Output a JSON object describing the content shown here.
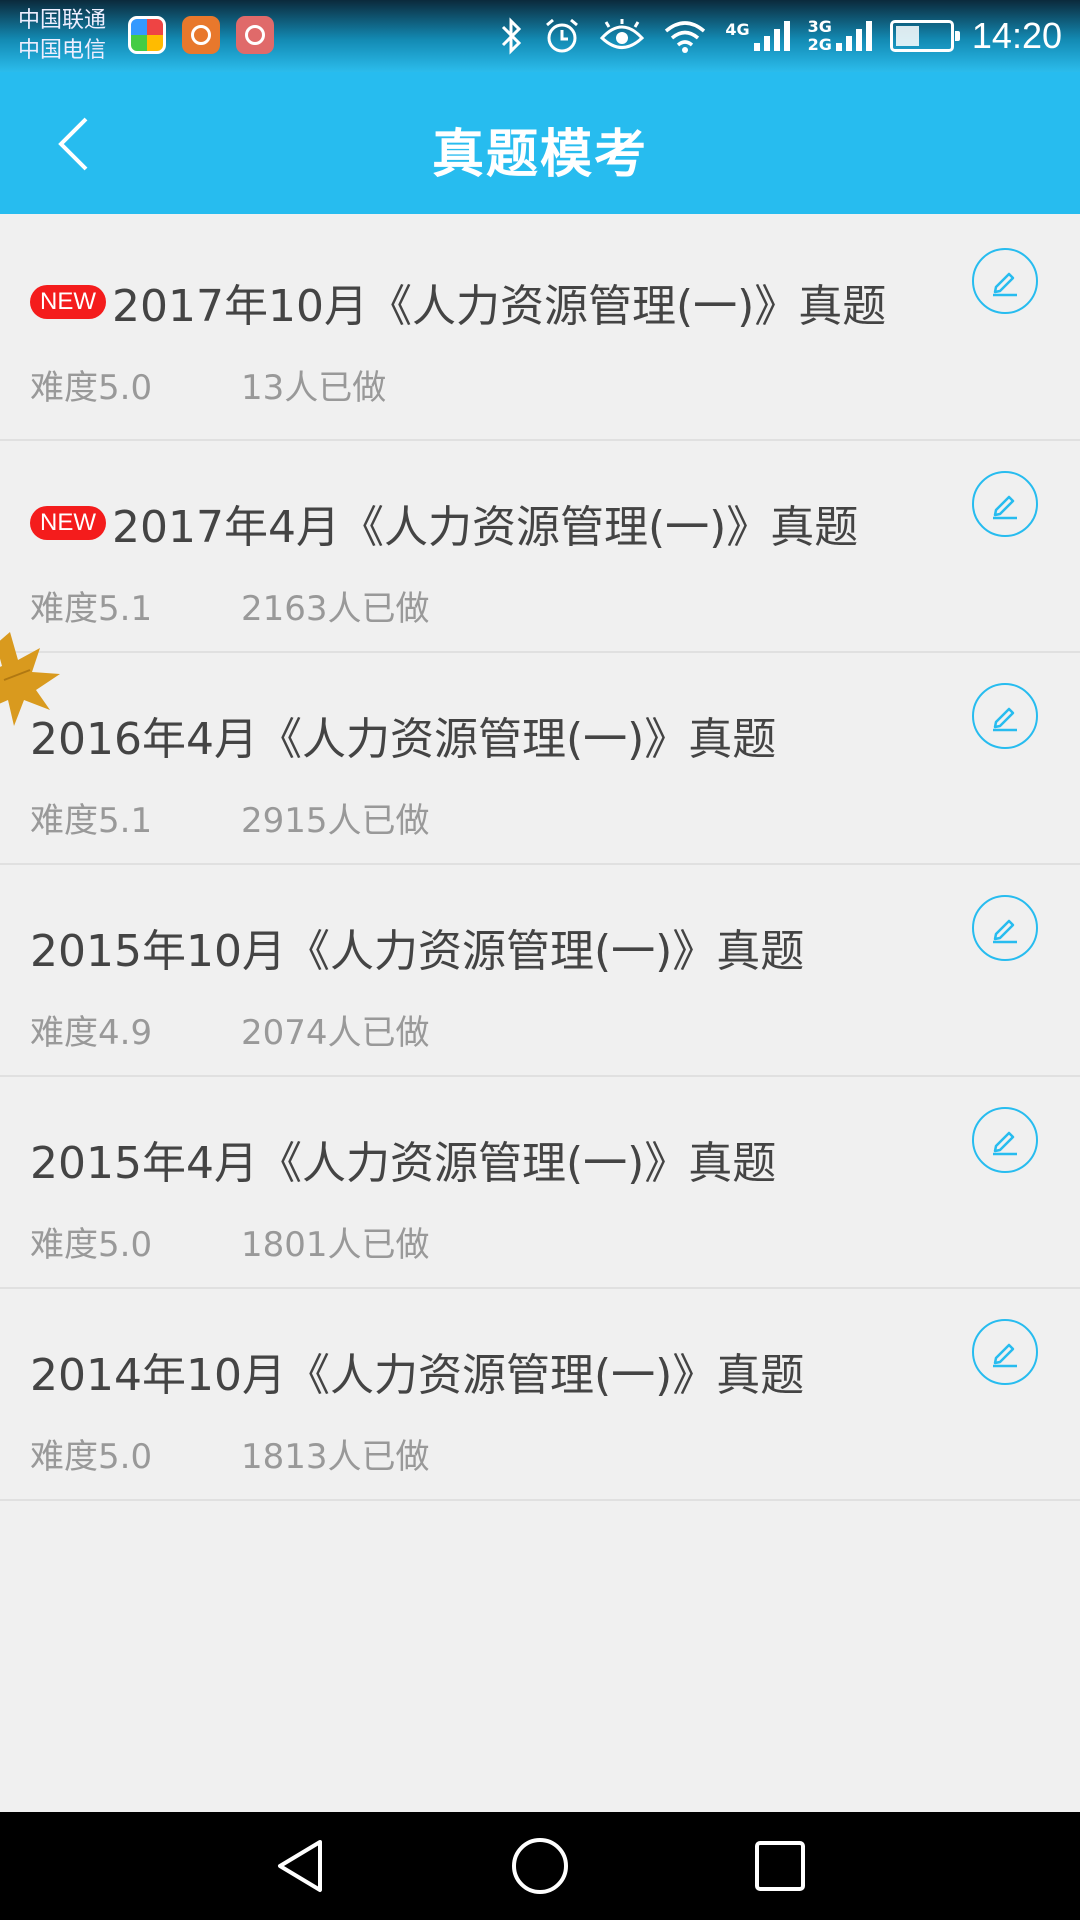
{
  "status_bar": {
    "carrier_1": "中国联通",
    "carrier_2": "中国电信",
    "network_1": "4G",
    "network_2a": "3G",
    "network_2b": "2G",
    "time": "14:20"
  },
  "header": {
    "title": "真题模考"
  },
  "items": [
    {
      "badge": "NEW",
      "title": "2017年10月《人力资源管理(一)》真题",
      "difficulty": "难度5.0",
      "done_count": "13人已做"
    },
    {
      "badge": "NEW",
      "title": "2017年4月《人力资源管理(一)》真题",
      "difficulty": "难度5.1",
      "done_count": "2163人已做"
    },
    {
      "title": "2016年4月《人力资源管理(一)》真题",
      "difficulty": "难度5.1",
      "done_count": "2915人已做"
    },
    {
      "title": "2015年10月《人力资源管理(一)》真题",
      "difficulty": "难度4.9",
      "done_count": "2074人已做"
    },
    {
      "title": "2015年4月《人力资源管理(一)》真题",
      "difficulty": "难度5.0",
      "done_count": "1801人已做"
    },
    {
      "title": "2014年10月《人力资源管理(一)》真题",
      "difficulty": "难度5.0",
      "done_count": "1813人已做"
    }
  ],
  "colors": {
    "accent": "#27bcef",
    "badge": "#f41c1c",
    "title_text": "#444444",
    "meta_text": "#999999"
  },
  "icons": [
    "back-arrow-icon",
    "edit-pencil-icon",
    "bluetooth-icon",
    "alarm-icon",
    "eye-icon",
    "wifi-icon",
    "signal-icon",
    "battery-icon",
    "nav-back-icon",
    "nav-home-icon",
    "nav-recents-icon"
  ]
}
